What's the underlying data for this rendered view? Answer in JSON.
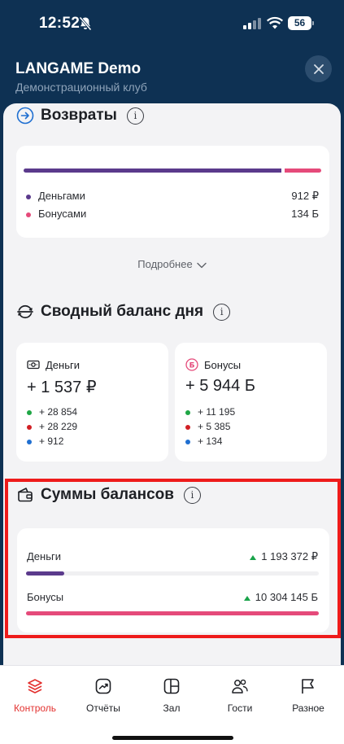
{
  "status": {
    "time": "12:52",
    "battery": "56"
  },
  "header": {
    "title": "LANGAME Demo",
    "subtitle": "Демонстрационный клуб",
    "close_icon": "close-icon"
  },
  "returns": {
    "title": "Возвраты",
    "split": {
      "money_fraction": 0.872,
      "bonus_fraction": 0.128
    },
    "items": [
      {
        "label": "Деньгами",
        "value": "912 ₽",
        "color": "#5b3a8c"
      },
      {
        "label": "Бонусами",
        "value": "134 Б",
        "color": "#e54a7a"
      }
    ],
    "more_label": "Подробнее"
  },
  "daily_balance": {
    "title": "Сводный баланс дня",
    "money": {
      "label": "Деньги",
      "total": "+ 1 537 ₽",
      "lines": [
        {
          "text": "+ 28 854",
          "color": "#1fa645"
        },
        {
          "text": "+ 28 229",
          "color": "#d11f24"
        },
        {
          "text": "+ 912",
          "color": "#1f6fd1"
        }
      ]
    },
    "bonus": {
      "label": "Бонусы",
      "total": "+ 5 944 Б",
      "lines": [
        {
          "text": "+ 11 195",
          "color": "#1fa645"
        },
        {
          "text": "+ 5 385",
          "color": "#d11f24"
        },
        {
          "text": "+ 134",
          "color": "#1f6fd1"
        }
      ]
    }
  },
  "balance_sums": {
    "title": "Суммы балансов",
    "money": {
      "label": "Деньги",
      "value": "1 193 372 ₽",
      "fill_fraction": 0.13,
      "color": "#5b3a8c"
    },
    "bonus": {
      "label": "Бонусы",
      "value": "10 304 145 Б",
      "fill_fraction": 1.0,
      "color": "#e54a7a"
    }
  },
  "tabs": [
    {
      "label": "Контроль",
      "icon": "layers-icon",
      "active": true
    },
    {
      "label": "Отчёты",
      "icon": "chart-icon",
      "active": false
    },
    {
      "label": "Зал",
      "icon": "hall-icon",
      "active": false
    },
    {
      "label": "Гости",
      "icon": "guests-icon",
      "active": false
    },
    {
      "label": "Разное",
      "icon": "flag-icon",
      "active": false
    }
  ],
  "colors": {
    "header_bg": "#0e3153",
    "accent": "#e3312f",
    "money": "#5b3a8c",
    "bonus": "#e54a7a"
  }
}
